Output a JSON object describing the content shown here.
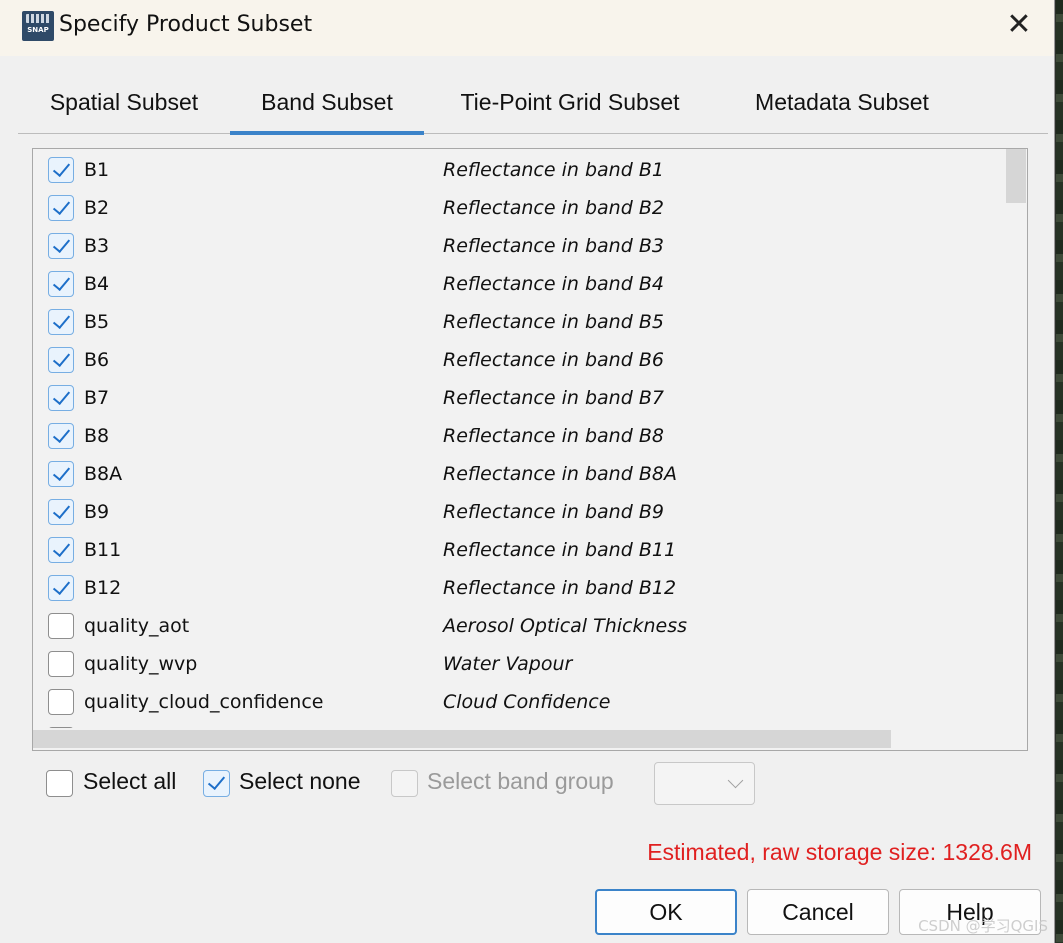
{
  "window": {
    "title": "Specify Product Subset",
    "app_icon_label": "SNAP",
    "close_glyph": "✕"
  },
  "tabs": [
    {
      "label": "Spatial Subset",
      "active": false
    },
    {
      "label": "Band Subset",
      "active": true
    },
    {
      "label": "Tie-Point Grid Subset",
      "active": false
    },
    {
      "label": "Metadata Subset",
      "active": false
    }
  ],
  "bands": [
    {
      "name": "B1",
      "description": "Reflectance in band B1",
      "checked": true
    },
    {
      "name": "B2",
      "description": "Reflectance in band B2",
      "checked": true
    },
    {
      "name": "B3",
      "description": "Reflectance in band B3",
      "checked": true
    },
    {
      "name": "B4",
      "description": "Reflectance in band B4",
      "checked": true
    },
    {
      "name": "B5",
      "description": "Reflectance in band B5",
      "checked": true
    },
    {
      "name": "B6",
      "description": "Reflectance in band B6",
      "checked": true
    },
    {
      "name": "B7",
      "description": "Reflectance in band B7",
      "checked": true
    },
    {
      "name": "B8",
      "description": "Reflectance in band B8",
      "checked": true
    },
    {
      "name": "B8A",
      "description": "Reflectance in band B8A",
      "checked": true
    },
    {
      "name": "B9",
      "description": "Reflectance in band B9",
      "checked": true
    },
    {
      "name": "B11",
      "description": "Reflectance in band B11",
      "checked": true
    },
    {
      "name": "B12",
      "description": "Reflectance in band B12",
      "checked": true
    },
    {
      "name": "quality_aot",
      "description": "Aerosol Optical Thickness",
      "checked": false
    },
    {
      "name": "quality_wvp",
      "description": "Water Vapour",
      "checked": false
    },
    {
      "name": "quality_cloud_confidence",
      "description": "Cloud Confidence",
      "checked": false
    }
  ],
  "options": {
    "select_all": {
      "label": "Select all",
      "checked": false
    },
    "select_none": {
      "label": "Select none",
      "checked": true
    },
    "select_band_group": {
      "label": "Select band group",
      "checked": false,
      "enabled": false
    }
  },
  "estimate": "Estimated, raw storage size: 1328.6M",
  "buttons": {
    "ok": "OK",
    "cancel": "Cancel",
    "help": "Help"
  },
  "watermark": "CSDN @学习QGIS",
  "colors": {
    "accent": "#3b83c9",
    "estimate_text": "#e02020",
    "check": "#1d6fc9"
  }
}
